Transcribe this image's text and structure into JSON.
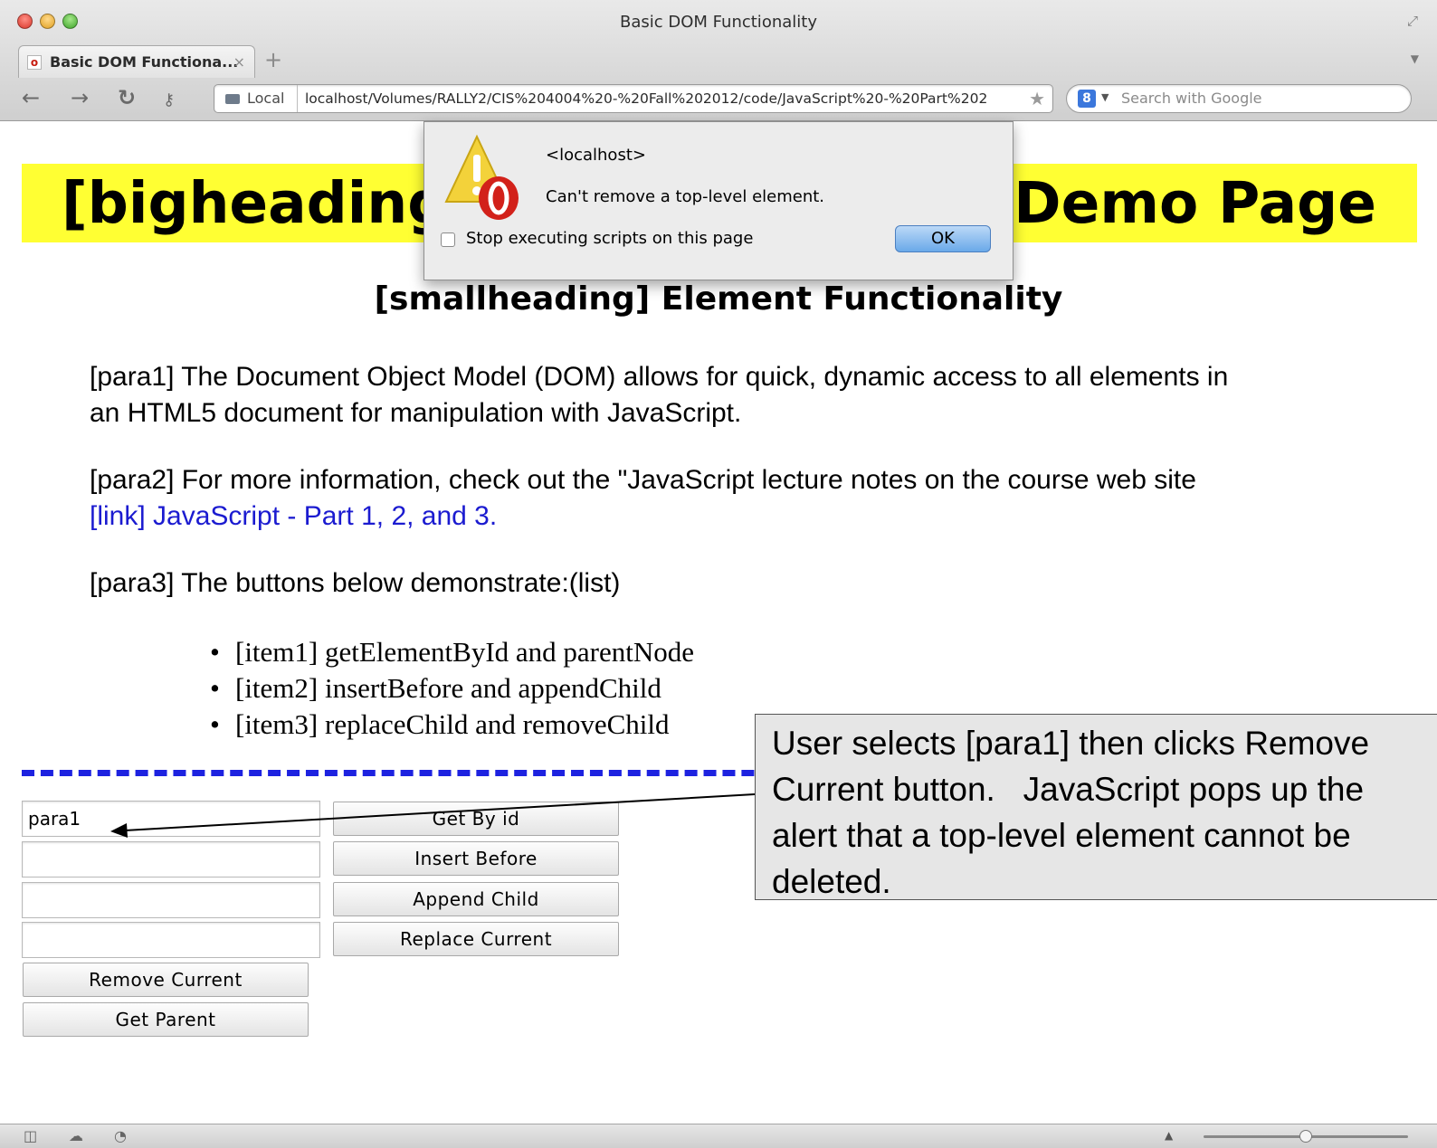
{
  "window": {
    "title": "Basic DOM Functionality",
    "tab_label": "Basic DOM Functiona...",
    "tab_close": "×",
    "new_tab": "+",
    "url_scope": "Local",
    "url": "localhost/Volumes/RALLY2/CIS%204004%20-%20Fall%202012/code/JavaScript%20-%20Part%202",
    "search_placeholder": "Search with Google",
    "google_glyph": "8"
  },
  "icons": {
    "back": "back-arrow-icon",
    "forward": "forward-arrow-icon",
    "reload": "reload-icon",
    "key": "key-icon",
    "star": "bookmark-star-icon",
    "warning": "warning-triangle-icon"
  },
  "page": {
    "bigheading_left": "[bigheading",
    "bigheading_right": "Demo Page",
    "smallheading": "[smallheading] Element Functionality",
    "para1": "[para1] The Document Object Model (DOM) allows for quick, dynamic access to all elements in an HTML5 document for manipulation with JavaScript.",
    "para2": "[para2] For more information, check out the \"JavaScript lecture notes on the course web site",
    "para2_link": "[link] JavaScript - Part 1, 2, and 3.",
    "para3": "[para3] The buttons below demonstrate:(list)",
    "list": [
      "[item1] getElementById and parentNode",
      "[item2] insertBefore and appendChild",
      "[item3] replaceChild and removeChild"
    ]
  },
  "controls": {
    "fields": [
      "para1",
      "",
      "",
      ""
    ],
    "buttons_right": [
      "Get By id",
      "Insert Before",
      "Append Child",
      "Replace Current"
    ],
    "buttons_left": [
      "Remove Current",
      "Get Parent"
    ]
  },
  "alert": {
    "title": "<localhost>",
    "message": "Can't remove a top-level element.",
    "checkbox_label": "Stop executing scripts on this page",
    "ok_label": "OK"
  },
  "callout": {
    "text": "User selects [para1] then clicks Remove Current button.   JavaScript pops up the alert that a top-level element cannot be deleted."
  },
  "colors": {
    "bigheading_bg": "#ffff33",
    "link": "#1b1bd0",
    "dashed_line": "#1d22e0"
  },
  "zoom_level": 0.5
}
